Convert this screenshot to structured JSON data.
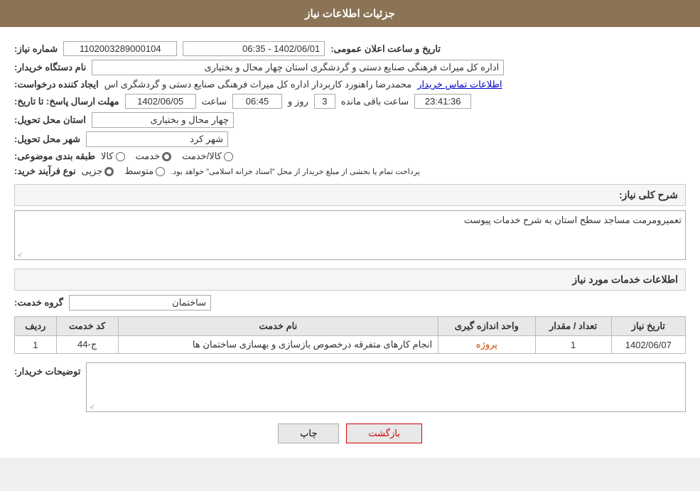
{
  "header": {
    "title": "جزئیات اطلاعات نیاز"
  },
  "fields": {
    "need_number_label": "شماره نیاز:",
    "need_number_value": "1102003289000104",
    "date_label": "تاریخ و ساعت اعلان عمومی:",
    "date_value": "1402/06/01 - 06:35",
    "buyer_org_label": "نام دستگاه خریدار:",
    "buyer_org_value": "اداره کل میراث فرهنگی  صنایع دستی و گردشگری استان چهار محال و بختیاری",
    "creator_label": "ایجاد کننده درخواست:",
    "creator_value": "محمدرضا راهنورد کاربردار اداره کل میراث فرهنگی  صنایع دستی و گردشگری اس",
    "contact_link": "اطلاعات تماس خریدار",
    "deadline_label": "مهلت ارسال پاسخ: تا تاریخ:",
    "deadline_date": "1402/06/05",
    "deadline_time_label": "ساعت",
    "deadline_time": "06:45",
    "deadline_day_label": "روز و",
    "deadline_days": "3",
    "deadline_remaining_label": "ساعت باقی مانده",
    "deadline_remaining": "23:41:36",
    "province_label": "استان محل تحویل:",
    "province_value": "چهار محال و بختیاری",
    "city_label": "شهر محل تحویل:",
    "city_value": "شهر کرد",
    "category_label": "طبقه بندی موضوعی:",
    "category_options": [
      "کالا",
      "خدمت",
      "کالا/خدمت"
    ],
    "category_selected": "خدمت",
    "purchase_type_label": "نوع فرآیند خرید:",
    "purchase_type_options": [
      "جزیی",
      "متوسط"
    ],
    "purchase_type_note": "پرداخت تمام یا بخشی از مبلغ خریدار از محل \"اسناد خزانه اسلامی\" خواهد بود.",
    "need_description_label": "شرح کلی نیاز:",
    "need_description_value": "تعمیرومرمت مساجد سطح استان به شرح خدمات پیوست",
    "services_section_title": "اطلاعات خدمات مورد نیاز",
    "service_group_label": "گروه خدمت:",
    "service_group_value": "ساختمان",
    "table_headers": [
      "ردیف",
      "کد خدمت",
      "نام خدمت",
      "واحد اندازه گیری",
      "تعداد / مقدار",
      "تاریخ نیاز"
    ],
    "table_rows": [
      {
        "row": "1",
        "code": "ج-44",
        "name": "انجام کارهای متفرقه درخصوص بازسازی و بهسازی ساختمان ها",
        "unit": "پروژه",
        "quantity": "1",
        "date": "1402/06/07"
      }
    ],
    "buyer_notes_label": "توضیحات خریدار:",
    "buyer_notes_value": "",
    "btn_print": "چاپ",
    "btn_back": "بازگشت"
  }
}
